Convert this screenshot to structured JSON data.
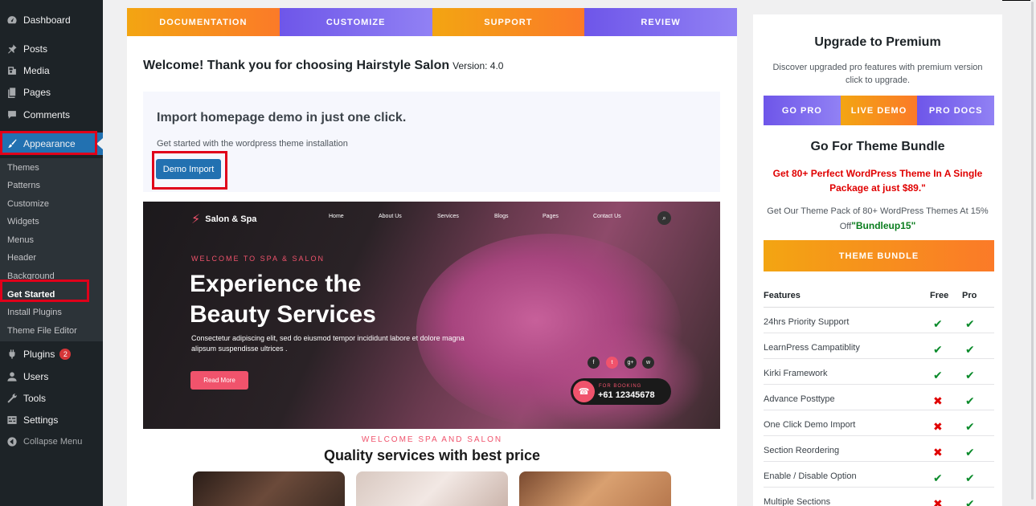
{
  "sidebar": {
    "items": [
      {
        "label": "Dashboard",
        "icon": "dashboard-icon"
      },
      {
        "label": "Posts",
        "icon": "pin-icon"
      },
      {
        "label": "Media",
        "icon": "media-icon"
      },
      {
        "label": "Pages",
        "icon": "pages-icon"
      },
      {
        "label": "Comments",
        "icon": "comment-icon"
      },
      {
        "label": "Appearance",
        "icon": "brush-icon"
      },
      {
        "label": "Plugins",
        "icon": "plugin-icon",
        "badge": "2"
      },
      {
        "label": "Users",
        "icon": "user-icon"
      },
      {
        "label": "Tools",
        "icon": "wrench-icon"
      },
      {
        "label": "Settings",
        "icon": "settings-icon"
      },
      {
        "label": "Collapse Menu",
        "icon": "collapse-icon"
      }
    ],
    "submenu": [
      "Themes",
      "Patterns",
      "Customize",
      "Widgets",
      "Menus",
      "Header",
      "Background",
      "Get Started",
      "Install Plugins",
      "Theme File Editor"
    ],
    "current_submenu": "Get Started",
    "active_color": "#2271b1",
    "highlight_color": "#e0001a"
  },
  "main": {
    "tabs": [
      "DOCUMENTATION",
      "CUSTOMIZE",
      "SUPPORT",
      "REVIEW"
    ],
    "welcome_title": "Welcome! Thank you for choosing Hairstyle Salon",
    "version": "Version: 4.0",
    "import": {
      "title": "Import homepage demo in just one click.",
      "subtitle": "Get started with the wordpress theme installation",
      "button": "Demo Import"
    },
    "hero": {
      "logo": "Salon & Spa",
      "nav": [
        "Home",
        "About Us",
        "Services",
        "Blogs",
        "Pages",
        "Contact Us"
      ],
      "kicker": "WELCOME TO SPA & SALON",
      "heading_line1": "Experience the",
      "heading_line2": "Beauty Services",
      "description": "Consectetur adipiscing elit, sed do eiusmod tempor incididunt labore et dolore magna alipsum suspendisse ultrices .",
      "button": "Read More",
      "social": [
        "f",
        "t",
        "g+",
        "w"
      ],
      "booking_label": "FOR BOOKING",
      "booking_number": "+61 12345678"
    },
    "services_kicker": "WELCOME SPA AND SALON",
    "services_title": "Quality services with best price"
  },
  "right": {
    "title": "Upgrade to Premium",
    "description": "Discover upgraded pro features with premium version click to upgrade.",
    "tabs": [
      "GO PRO",
      "LIVE DEMO",
      "PRO DOCS"
    ],
    "bundle_title": "Go For Theme Bundle",
    "bundle_offer": "Get 80+ Perfect WordPress Theme In A Single Package at just $89.\"",
    "bundle_pack": "Get Our Theme Pack of 80+ WordPress Themes At 15% Off",
    "bundle_code": "\"Bundleup15\"",
    "bundle_button": "THEME BUNDLE",
    "features_header": {
      "name": "Features",
      "free": "Free",
      "pro": "Pro"
    },
    "features": [
      {
        "name": "24hrs Priority Support",
        "free": true,
        "pro": true
      },
      {
        "name": "LearnPress Campatiblity",
        "free": true,
        "pro": true
      },
      {
        "name": "Kirki Framework",
        "free": true,
        "pro": true
      },
      {
        "name": "Advance Posttype",
        "free": false,
        "pro": true
      },
      {
        "name": "One Click Demo Import",
        "free": false,
        "pro": true
      },
      {
        "name": "Section Reordering",
        "free": false,
        "pro": true
      },
      {
        "name": "Enable / Disable Option",
        "free": true,
        "pro": true
      },
      {
        "name": "Multiple Sections",
        "free": false,
        "pro": true
      }
    ],
    "check_glyph": "✔",
    "cross_glyph": "✖"
  }
}
